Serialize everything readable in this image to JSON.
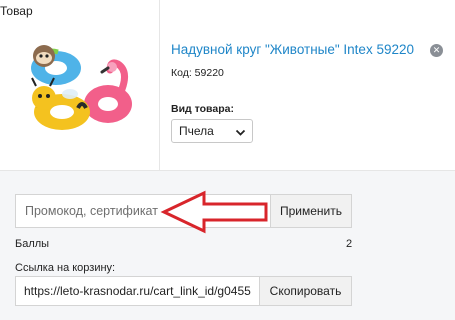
{
  "table": {
    "header_label": "Товар"
  },
  "product": {
    "title": "Надувной круг \"Животные\" Intex 59220",
    "code": "Код: 59220",
    "remove_icon": "close-circle-icon",
    "image": "inflatable-animal-rings",
    "variant_label": "Вид товара:",
    "variant_value": "Пчела"
  },
  "promo": {
    "placeholder": "Промокод, сертификат",
    "apply_label": "Применить",
    "arrow_color": "#d8252b"
  },
  "points": {
    "label": "Баллы",
    "value": "2"
  },
  "cart_link": {
    "label": "Ссылка на корзину:",
    "value": "https://leto-krasnodar.ru/cart_link_id/g0455",
    "copy_label": "Скопировать"
  },
  "colors": {
    "link": "#1f86c8"
  }
}
